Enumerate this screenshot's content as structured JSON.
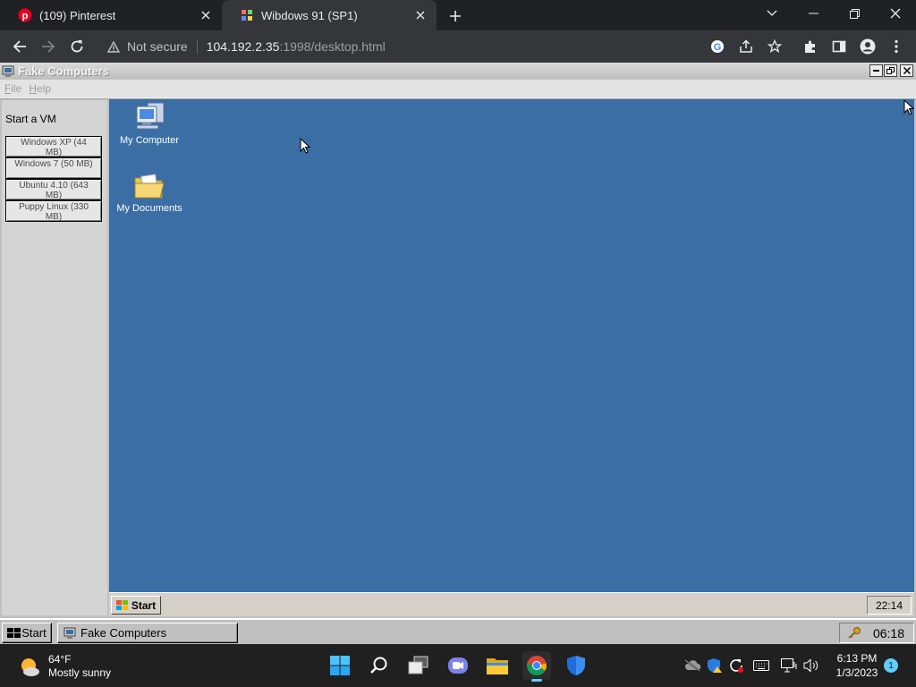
{
  "browser": {
    "tabs": [
      {
        "title": "(109) Pinterest",
        "icon": "pinterest-icon"
      },
      {
        "title": "Wibdows 91 (SP1)",
        "icon": "site-favicon"
      }
    ],
    "address": {
      "security_label": "Not secure",
      "host": "104.192.2.35",
      "rest": ":1998/desktop.html"
    }
  },
  "app": {
    "title": "Fake Computers",
    "menu": [
      "File",
      "Help"
    ],
    "sidebar": {
      "heading": "Start a VM",
      "vms": [
        "Windows XP (44 MB)",
        "Windows 7 (50 MB)",
        "Ubuntu 4.10 (643 MB)",
        "Puppy Linux (330 MB)"
      ]
    },
    "desktop": {
      "icons": [
        {
          "label": "My Computer",
          "icon": "computer-icon"
        },
        {
          "label": "My Documents",
          "icon": "folder-icon"
        }
      ],
      "taskbar": {
        "start_label": "Start",
        "clock": "22:14"
      }
    }
  },
  "outer_taskbar": {
    "start_label": "Start",
    "task_label": "Fake Computers",
    "clock": "06:18"
  },
  "windows_taskbar": {
    "weather": {
      "temp": "64°F",
      "condition": "Mostly sunny"
    },
    "time": "6:13 PM",
    "date": "1/3/2023",
    "notification_count": "1"
  },
  "colors": {
    "desktop_background": "#3a6ea5",
    "chrome_dark": "#202124",
    "win98_gray": "#c0c0c0"
  }
}
